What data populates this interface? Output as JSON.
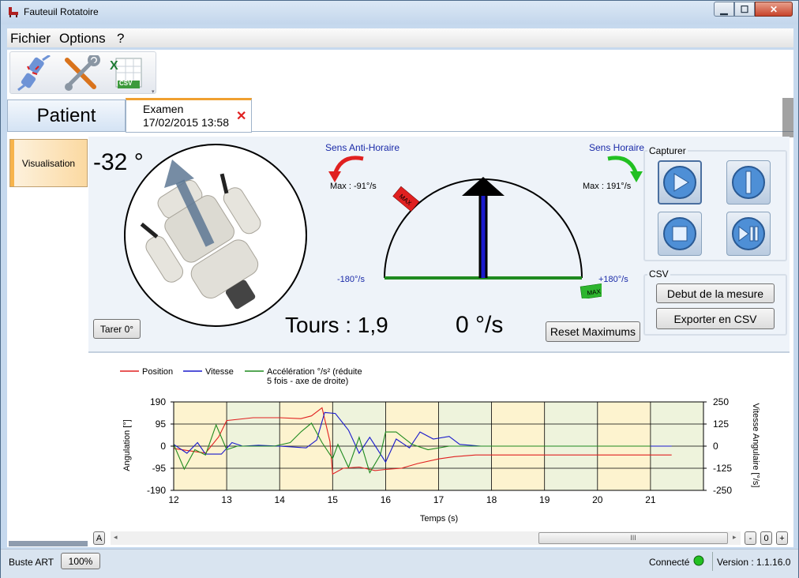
{
  "window": {
    "title": "Fauteuil Rotatoire",
    "minimize": "▁",
    "maximize": "☐",
    "close": "✕"
  },
  "menu": {
    "items": [
      "Fichier",
      "Options",
      "?"
    ]
  },
  "toolbar": {
    "icons": [
      "connect-plug-icon",
      "tools-icon",
      "csv-export-icon"
    ],
    "csv_badge": "CSV"
  },
  "tabs": {
    "patient_label": "Patient",
    "examen_label": "Examen",
    "examen_date": "17/02/2015 13:58",
    "close_glyph": "✕"
  },
  "sidebar": {
    "visualisation_label": "Visualisation"
  },
  "position": {
    "angle_text": "-32 °",
    "tare_label": "Tarer 0°",
    "tours_text": "Tours : 1,9"
  },
  "speed": {
    "value_text": "0 °/s",
    "ccw_label": "Sens Anti-Horaire",
    "cw_label": "Sens Horaire",
    "ccw_max_text": "Max : -91°/s",
    "cw_max_text": "Max : 191°/s",
    "left_scale": "-180°/s",
    "right_scale": "+180°/s",
    "max_badge": "MAX",
    "reset_label": "Reset Maximums"
  },
  "capture": {
    "group_label": "Capturer",
    "buttons": [
      "play-icon",
      "marker-icon",
      "stop-icon",
      "play-pause-icon"
    ]
  },
  "csv": {
    "group_label": "CSV",
    "start_label": "Debut de la mesure",
    "export_label": "Exporter en CSV"
  },
  "chart_data": {
    "type": "line",
    "xlabel": "Temps (s)",
    "ylabel": "Angulation [°]",
    "y2label": "Vitesse Angulaire [°/s]",
    "xlim": [
      12,
      22
    ],
    "ylim": [
      -190,
      190
    ],
    "y2lim": [
      -250,
      250
    ],
    "xticks": [
      12,
      13,
      14,
      15,
      16,
      17,
      18,
      19,
      20,
      21
    ],
    "yticks": [
      190,
      95,
      0,
      -95,
      -190
    ],
    "y2ticks": [
      250,
      125,
      0,
      -125,
      -250
    ],
    "legend": [
      "Position",
      "Vitesse",
      "Accélération °/s² (réduite",
      "5 fois - axe de droite)"
    ],
    "series": [
      {
        "name": "Position",
        "color": "#e02020",
        "axis": "left",
        "x": [
          12,
          12.3,
          12.6,
          12.85,
          13.0,
          13.5,
          14.0,
          14.4,
          14.6,
          14.8,
          14.95,
          15.0,
          15.2,
          15.5,
          15.8,
          16.0,
          16.3,
          16.6,
          17.0,
          17.3,
          17.7,
          18.5,
          19.5,
          20.5,
          21.4
        ],
        "y": [
          -10,
          -20,
          -30,
          40,
          110,
          122,
          122,
          118,
          130,
          165,
          20,
          -120,
          -95,
          -90,
          -105,
          -100,
          -95,
          -75,
          -55,
          -45,
          -38,
          -38,
          -38,
          -38,
          -38
        ]
      },
      {
        "name": "Vitesse",
        "color": "#1a1acc",
        "axis": "right",
        "x": [
          12,
          12.25,
          12.45,
          12.6,
          12.9,
          13.1,
          13.3,
          13.6,
          14.0,
          14.5,
          14.7,
          14.85,
          15.05,
          15.3,
          15.5,
          15.7,
          16.0,
          16.2,
          16.45,
          16.65,
          16.9,
          17.2,
          17.4,
          17.8,
          18.5,
          19.5,
          20.5,
          21.4
        ],
        "y": [
          10,
          -40,
          20,
          -45,
          -45,
          20,
          0,
          5,
          0,
          -10,
          35,
          190,
          185,
          90,
          -40,
          50,
          -90,
          40,
          -10,
          80,
          40,
          55,
          10,
          0,
          0,
          0,
          0,
          0
        ]
      },
      {
        "name": "Accélération",
        "color": "#1f8a1f",
        "axis": "right",
        "x": [
          12,
          12.2,
          12.4,
          12.6,
          12.8,
          13.0,
          13.2,
          13.5,
          13.9,
          14.2,
          14.4,
          14.6,
          14.8,
          15.0,
          15.1,
          15.3,
          15.5,
          15.7,
          15.9,
          16.0,
          16.2,
          16.5,
          16.8,
          17.2,
          17.5,
          18.0,
          19.0,
          20.0,
          21.0
        ],
        "y": [
          10,
          -130,
          -20,
          -50,
          120,
          -20,
          0,
          0,
          0,
          20,
          80,
          130,
          20,
          -70,
          10,
          -120,
          50,
          -150,
          -50,
          80,
          80,
          10,
          -20,
          0,
          0,
          0,
          0,
          0,
          0
        ]
      }
    ]
  },
  "chart_controls": {
    "a_label": "A",
    "minus": "-",
    "zero": "0",
    "plus": "+",
    "grip": "III"
  },
  "status": {
    "left_label": "Buste ART",
    "zoom_label": "100%",
    "connection_label": "Connecté",
    "connection_color": "#22c022",
    "version_label": "Version : 1.1.16.0"
  }
}
